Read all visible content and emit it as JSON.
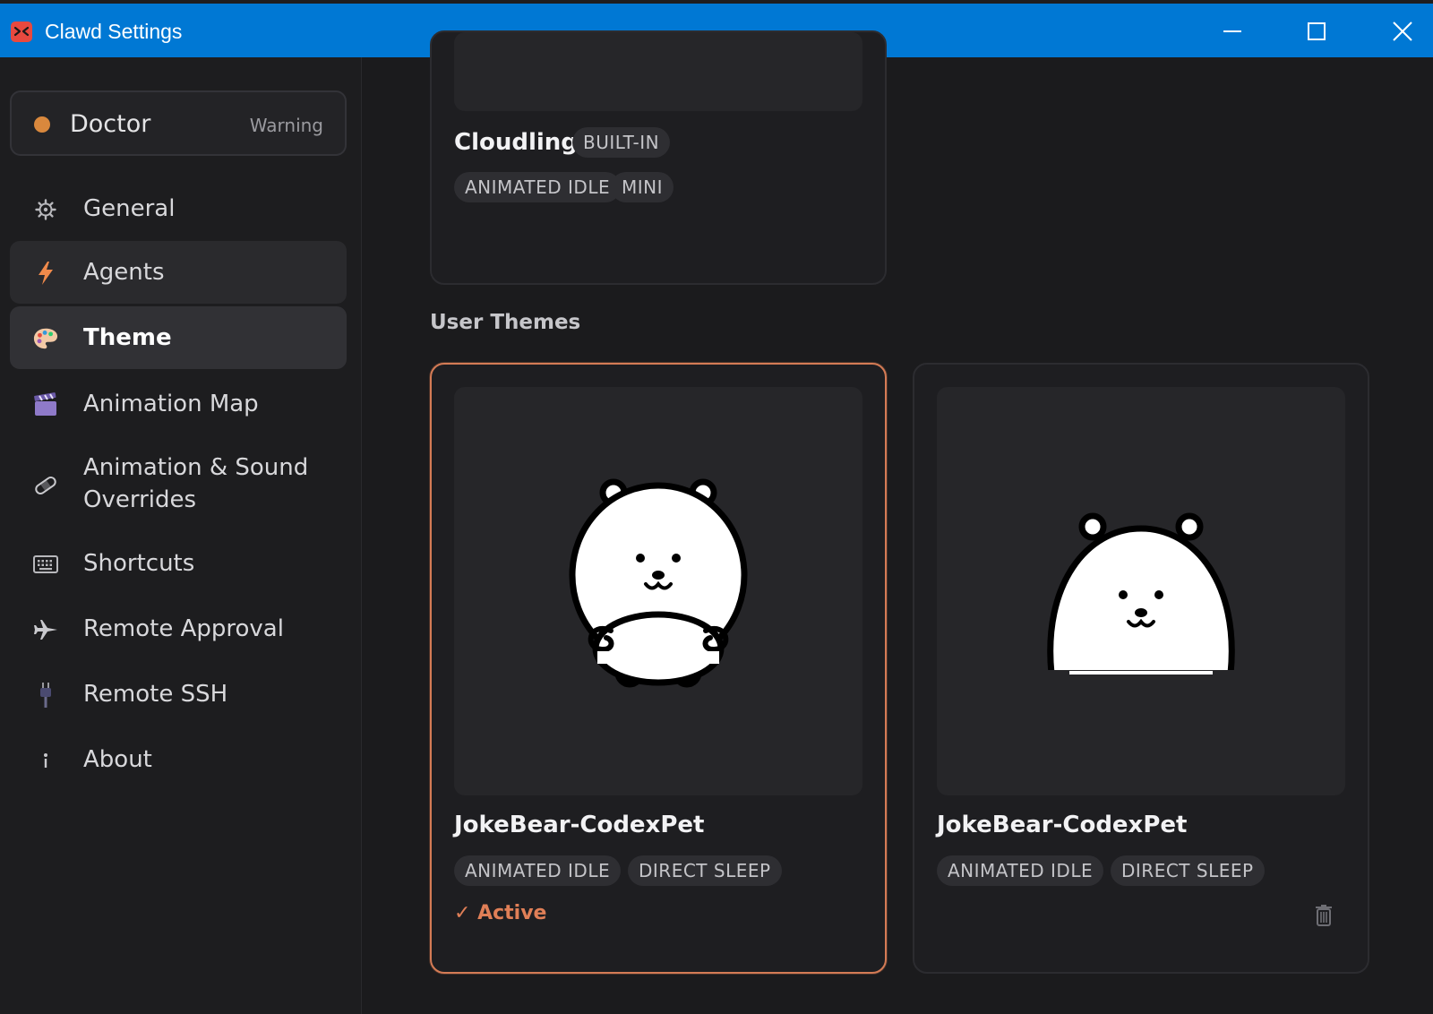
{
  "window": {
    "title": "Clawd Settings",
    "accent": "#0078d4",
    "icon": "clawd-app-icon"
  },
  "sidebar": {
    "doctor": {
      "label": "Doctor",
      "status": "Warning",
      "status_color": "#d9883d"
    },
    "items": [
      {
        "label": "General",
        "icon": "gear-icon"
      },
      {
        "label": "Agents",
        "icon": "lightning-icon"
      },
      {
        "label": "Theme",
        "icon": "palette-icon",
        "active": true
      },
      {
        "label": "Animation Map",
        "icon": "clapperboard-icon"
      },
      {
        "label_line1": "Animation & Sound",
        "label_line2": "Overrides",
        "icon": "bandage-icon"
      },
      {
        "label": "Shortcuts",
        "icon": "keyboard-icon"
      },
      {
        "label": "Remote Approval",
        "icon": "airplane-icon"
      },
      {
        "label": "Remote SSH",
        "icon": "plug-icon"
      },
      {
        "label": "About",
        "icon": "info-icon"
      }
    ]
  },
  "builtin_theme": {
    "name": "Cloudling",
    "badge": "BUILT-IN",
    "tags": [
      "ANIMATED IDLE",
      "MINI"
    ]
  },
  "user_themes": {
    "section_title": "User Themes",
    "accent": "#e07f57",
    "cards": [
      {
        "name": "JokeBear-CodexPet",
        "tags": [
          "ANIMATED IDLE",
          "DIRECT SLEEP"
        ],
        "status": "✓ Active",
        "preview": "bear-standing-sprite"
      },
      {
        "name": "JokeBear-CodexPet",
        "tags": [
          "ANIMATED IDLE",
          "DIRECT SLEEP"
        ],
        "preview": "bear-sitting-sprite",
        "delete_icon": "trash-icon"
      }
    ]
  }
}
